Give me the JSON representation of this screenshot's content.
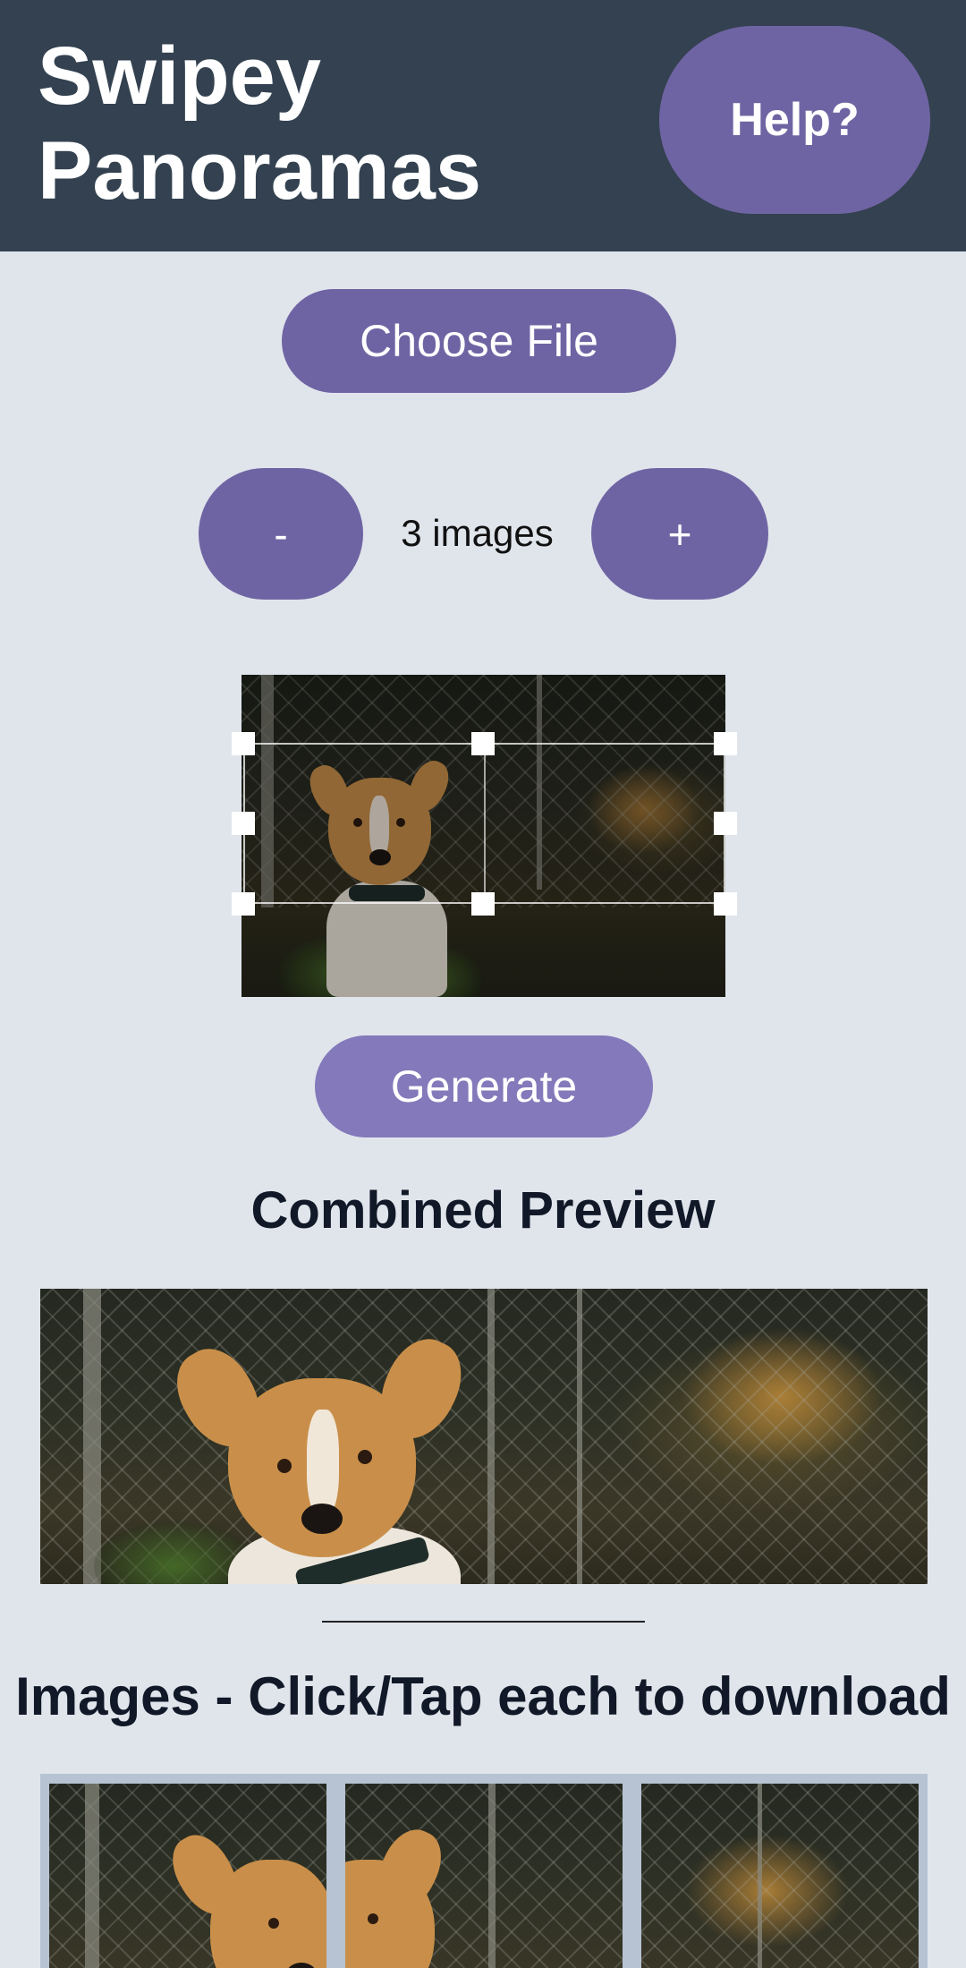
{
  "header": {
    "title": "Swipey Panoramas",
    "help_label": "Help?"
  },
  "controls": {
    "choose_file_label": "Choose File",
    "decrement_label": "-",
    "increment_label": "+",
    "image_count_label": "3 images",
    "generate_label": "Generate"
  },
  "combined": {
    "title": "Combined Preview"
  },
  "images_section": {
    "title": "Images - Click/Tap each to download"
  },
  "colors": {
    "header_bg": "#334150",
    "accent": "#6f64a3",
    "page_bg": "#e0e5ec"
  }
}
